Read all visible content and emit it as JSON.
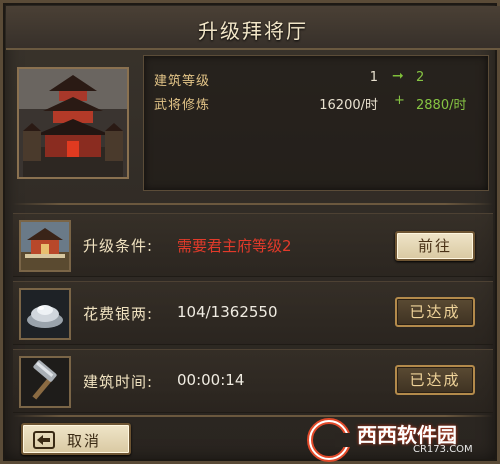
{
  "dialog": {
    "title": "升级拜将厅"
  },
  "building": {
    "name": "pavilion-building"
  },
  "stats": {
    "level": {
      "label": "建筑等级",
      "from": "1",
      "to": "2"
    },
    "training": {
      "label": "武将修炼",
      "from": "16200/时",
      "plus": "+",
      "to": "2880/时"
    }
  },
  "requirements": [
    {
      "label": "升级条件:",
      "value": "需要君主府等级2",
      "button": "前往",
      "status": "pending",
      "icon": "palace-icon",
      "value_color": "#e23a2a"
    },
    {
      "label": "花费银两:",
      "value": "104/1362550",
      "button": "已达成",
      "status": "done",
      "icon": "silver-ingot-icon"
    },
    {
      "label": "建筑时间:",
      "value": "00:00:14",
      "button": "已达成",
      "status": "done",
      "icon": "hammer-icon"
    }
  ],
  "footer": {
    "cancel_label": "取消"
  },
  "watermark": {
    "brand": "西西软件园",
    "url": "CR173.COM"
  },
  "colors": {
    "accent_gold": "#e2c487",
    "increase_green": "#86c443",
    "warning_red": "#e23a2a"
  }
}
